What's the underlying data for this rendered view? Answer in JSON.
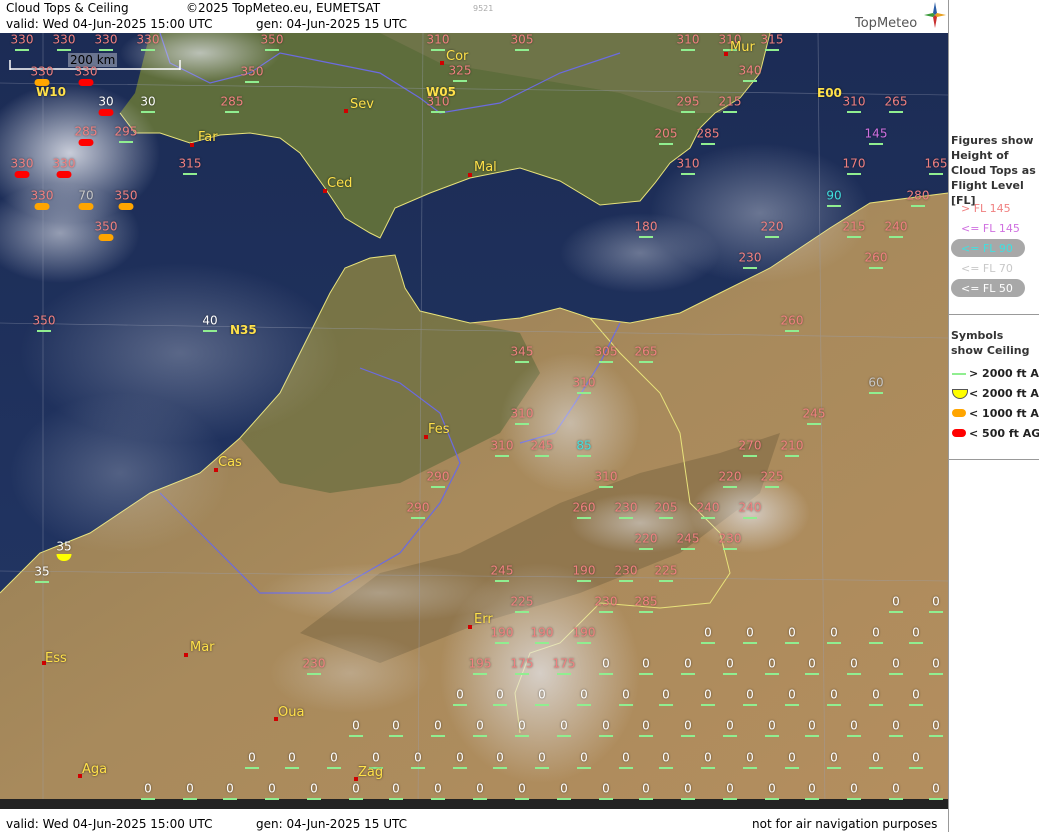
{
  "header": {
    "title": "Cloud Tops & Ceiling",
    "copyright": "©2025 TopMeteo.eu, EUMETSAT",
    "valid": "valid:  Wed  04-Jun-2025  15:00 UTC",
    "generated": "gen: 04-Jun-2025 15 UTC",
    "code": "9521",
    "brand": "TopMeteo"
  },
  "footer": {
    "valid": "valid:  Wed  04-Jun-2025  15:00 UTC",
    "generated": "gen: 04-Jun-2025 15 UTC",
    "disclaimer": "not for air navigation purposes"
  },
  "map": {
    "scale_label": "200 km",
    "grid_labels": [
      "W10",
      "W05",
      "E00",
      "N35"
    ],
    "cities": [
      "Cor",
      "Mur",
      "Sev",
      "Far",
      "Ced",
      "Mal",
      "Fes",
      "Cas",
      "Err",
      "Mar",
      "Ess",
      "Oua",
      "Zag",
      "Aga"
    ]
  },
  "legend": {
    "tops_heading": "Figures show Height of Cloud Tops as Flight Level  [FL]",
    "tops_items": [
      {
        "label": "> FL 145",
        "color": "#f08080"
      },
      {
        "label": "<= FL 145",
        "color": "#d070e0"
      },
      {
        "label": "<= FL 90",
        "color": "#40e0e0"
      },
      {
        "label": "<= FL 70",
        "color": "#c8c8c8"
      },
      {
        "label": "<= FL 50",
        "color": "#ffffff"
      }
    ],
    "ceiling_heading": "Symbols show Ceiling",
    "ceiling_items": [
      {
        "label": "> 2000 ft AGL",
        "color": "#90ee90"
      },
      {
        "label": "< 2000 ft AGL",
        "color": "#ffff00"
      },
      {
        "label": "< 1000 ft AGL",
        "color": "#ffa500"
      },
      {
        "label": "< 500 ft AGL",
        "color": "#ff0000"
      }
    ]
  },
  "cloud_tops": [
    "330",
    "330",
    "330",
    "330",
    "350",
    "310",
    "305",
    "310",
    "310",
    "315",
    "325",
    "340",
    "330",
    "330",
    "350",
    "285",
    "310",
    "295",
    "215",
    "310",
    "265",
    "30",
    "30",
    "285",
    "295",
    "205",
    "285",
    "145",
    "330",
    "330",
    "315",
    "310",
    "170",
    "165",
    "330",
    "70",
    "350",
    "90",
    "280",
    "350",
    "180",
    "220",
    "215",
    "240",
    "230",
    "260",
    "350",
    "40",
    "260",
    "345",
    "305",
    "265",
    "310",
    "60",
    "310",
    "245",
    "310",
    "245",
    "85",
    "270",
    "210",
    "290",
    "310",
    "220",
    "225",
    "290",
    "260",
    "230",
    "205",
    "240",
    "240",
    "220",
    "245",
    "230",
    "245",
    "190",
    "230",
    "225",
    "225",
    "230",
    "285",
    "190",
    "190",
    "190",
    "230",
    "195",
    "175",
    "175",
    "0",
    "35",
    "35"
  ]
}
